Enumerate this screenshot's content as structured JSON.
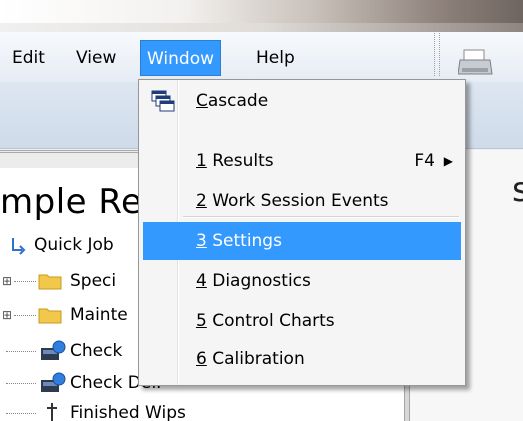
{
  "menubar": {
    "items": [
      {
        "label": "Edit"
      },
      {
        "label": "View"
      },
      {
        "label": "Window"
      },
      {
        "label": "Help"
      }
    ]
  },
  "panel": {
    "title": "mple Re",
    "right_edge": "s"
  },
  "tree": {
    "items": [
      {
        "label": "Quick Job",
        "icon": "quick-job-arrow-icon"
      },
      {
        "label": "Speci",
        "icon": "folder-icon"
      },
      {
        "label": "Mainte",
        "icon": "folder-icon"
      },
      {
        "label": "Check",
        "icon": "check-device-icon"
      },
      {
        "label": "Check Def.",
        "icon": "check-device-icon"
      },
      {
        "label": "Finished Wips",
        "icon": "finished-icon"
      }
    ]
  },
  "window_menu": {
    "cascade": {
      "mnemonic": "C",
      "rest": "ascade",
      "icon": "cascade-windows-icon"
    },
    "items": [
      {
        "number": "1",
        "label": " Results",
        "shortcut": "F4",
        "has_submenu": true
      },
      {
        "number": "2",
        "label": " Work Session Events"
      },
      {
        "number": "3",
        "label": " Settings",
        "highlighted": true
      },
      {
        "number": "4",
        "label": " Diagnostics"
      },
      {
        "number": "5",
        "label": " Control Charts"
      },
      {
        "number": "6",
        "label": " Calibration"
      }
    ]
  },
  "colors": {
    "highlight": "#3399ff",
    "menu_background": "#f5f5f5",
    "folder": "#f2c84b"
  }
}
